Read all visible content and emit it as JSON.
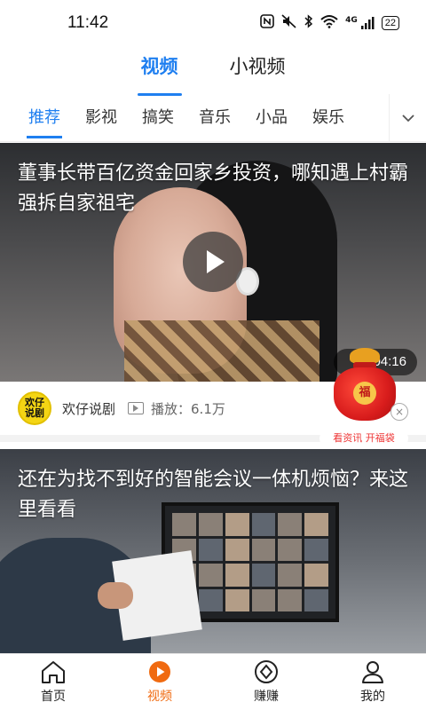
{
  "status_bar": {
    "time": "11:42",
    "icons": [
      "nfc-icon",
      "mute-icon",
      "bluetooth-icon",
      "wifi-icon",
      "signal-icon"
    ],
    "network": "4G",
    "battery": "22",
    "battery_level": 0.22
  },
  "top_tabs": [
    {
      "label": "视频",
      "active": true
    },
    {
      "label": "小视频",
      "active": false
    }
  ],
  "categories": [
    {
      "label": "推荐",
      "active": true
    },
    {
      "label": "影视",
      "active": false
    },
    {
      "label": "搞笑",
      "active": false
    },
    {
      "label": "音乐",
      "active": false
    },
    {
      "label": "小品",
      "active": false
    },
    {
      "label": "娱乐",
      "active": false
    }
  ],
  "videos": [
    {
      "title": "董事长带百亿资金回家乡投资，哪知遇上村霸强拆自家祖宅",
      "duration": "04:16",
      "author": "欢仔说剧",
      "author_avatar_text": "欢仔说剧",
      "plays": "播放：6.1万"
    },
    {
      "title": "还在为找不到好的智能会议一体机烦恼？来这里看看"
    }
  ],
  "floating_widget": {
    "bag_char": "福",
    "close": "×",
    "label": "看资讯 开福袋"
  },
  "bottom_nav": [
    {
      "label": "首页",
      "icon": "home-icon",
      "active": false
    },
    {
      "label": "视频",
      "icon": "video-icon",
      "active": true
    },
    {
      "label": "赚赚",
      "icon": "earn-icon",
      "active": false
    },
    {
      "label": "我的",
      "icon": "profile-icon",
      "active": false
    }
  ],
  "colors": {
    "accent": "#1f7ff0",
    "nav_active": "#f06a10",
    "avatar_bg": "#f4d514",
    "bag_red": "#d81c1c"
  }
}
